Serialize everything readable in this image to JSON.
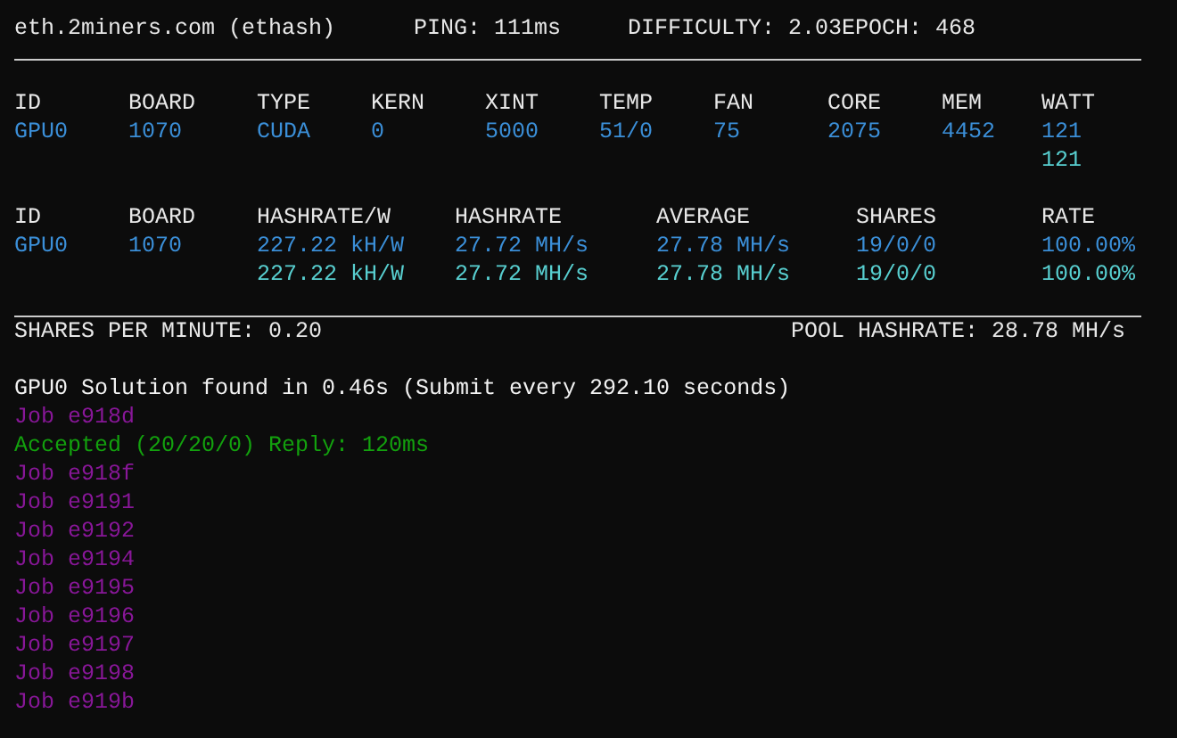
{
  "status_line": [
    "eth.2miners.com (ethash)",
    "PING: 111ms",
    "DIFFICULTY: 2.03",
    "EPOCH: 468"
  ],
  "device_table": {
    "columns": [
      "ID",
      "BOARD",
      "TYPE",
      "KERN",
      "XINT",
      "TEMP",
      "FAN",
      "CORE",
      "MEM",
      "WATT"
    ],
    "rows": [
      {
        "kind": "device",
        "cells": [
          "GPU0",
          "1070",
          "CUDA",
          "0",
          "5000",
          "51/0",
          "75",
          "2075",
          "4452",
          "121"
        ]
      },
      {
        "kind": "total",
        "cells": [
          null,
          null,
          null,
          null,
          null,
          null,
          null,
          null,
          null,
          "121"
        ]
      }
    ]
  },
  "hashrate_table": {
    "columns": [
      "ID",
      "BOARD",
      "HASHRATE/W",
      "HASHRATE",
      "AVERAGE",
      "SHARES",
      "RATE"
    ],
    "rows": [
      {
        "kind": "device",
        "cells": [
          "GPU0",
          "1070",
          "227.22 kH/W",
          "27.72 MH/s",
          "27.78 MH/s",
          "19/0/0",
          "100.00%"
        ]
      },
      {
        "kind": "total",
        "cells": [
          null,
          null,
          "227.22 kH/W",
          "27.72 MH/s",
          "27.78 MH/s",
          "19/0/0",
          "100.00%"
        ]
      }
    ]
  },
  "summary": {
    "shares_per_minute": "SHARES PER MINUTE: 0.20",
    "pool_hashrate": "POOL HASHRATE: 28.78 MH/s"
  },
  "log": [
    {
      "kind": "info",
      "text": "GPU0 Solution found in 0.46s (Submit every 292.10 seconds)"
    },
    {
      "kind": "job",
      "text": "Job e918d"
    },
    {
      "kind": "accepted",
      "text": "Accepted (20/20/0) Reply: 120ms"
    },
    {
      "kind": "job",
      "text": "Job e918f"
    },
    {
      "kind": "job",
      "text": "Job e9191"
    },
    {
      "kind": "job",
      "text": "Job e9192"
    },
    {
      "kind": "job",
      "text": "Job e9194"
    },
    {
      "kind": "job",
      "text": "Job e9195"
    },
    {
      "kind": "job",
      "text": "Job e9196"
    },
    {
      "kind": "job",
      "text": "Job e9197"
    },
    {
      "kind": "job",
      "text": "Job e9198"
    },
    {
      "kind": "job",
      "text": "Job e919b"
    }
  ]
}
